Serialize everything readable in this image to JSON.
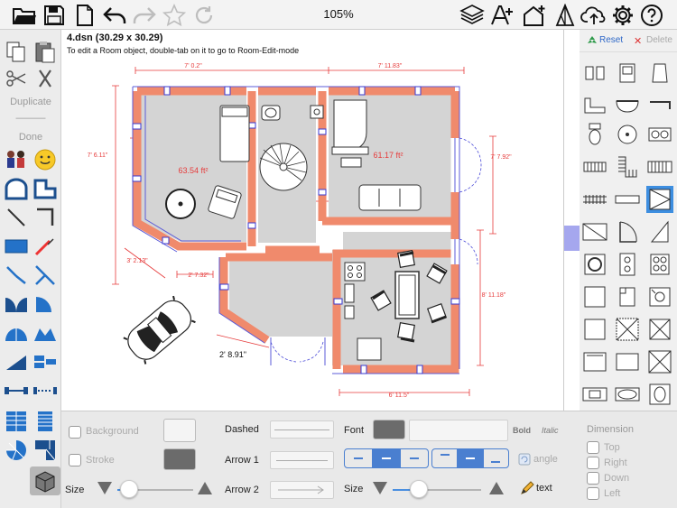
{
  "app": {
    "zoom_level": "105%",
    "file_title": "4.dsn (30.29 x 30.29)",
    "hint": "To edit a Room object, double-tab on it to go to Room-Edit-mode"
  },
  "toolbar": {
    "icons": [
      "folder-open-icon",
      "save-icon",
      "new-document-icon",
      "undo-icon",
      "redo-icon",
      "star-icon",
      "refresh-icon",
      "layers-icon",
      "text-add-icon",
      "house-add-icon",
      "perspective-icon",
      "cloud-upload-icon",
      "gear-icon",
      "help-icon"
    ]
  },
  "left_sidebar": {
    "duplicate_label": "Duplicate",
    "separator_label": "———",
    "done_label": "Done"
  },
  "right_panel": {
    "reset_label": "Reset",
    "delete_label": "Delete"
  },
  "plan": {
    "dimensions": {
      "top_left_width": "7' 0.2\"",
      "top_right_width": "7' 11.83\"",
      "left_height": "7' 6.11\"",
      "right_height": "7' 7.92\"",
      "bay_diagonal": "3' 2.13\"",
      "bay_bottom": "2' 7.32\"",
      "right_lower_height": "8' 11.18\"",
      "entry_width": "2' 8.91\"",
      "bottom_width": "6' 11.5\""
    },
    "areas": {
      "left_room": "63.54 ft²",
      "right_room": "61.17 ft²"
    },
    "colors": {
      "wall": "#f08a6c",
      "wall_outline": "#5b5bd8",
      "floor": "#d4d4d4",
      "dimension": "#e63b3b"
    }
  },
  "bottom_panel": {
    "background_label": "Background",
    "stroke_label": "Stroke",
    "size_label": "Size",
    "dashed_label": "Dashed",
    "arrow1_label": "Arrow 1",
    "arrow2_label": "Arrow 2",
    "font_label": "Font",
    "bold_label": "Bold",
    "italic_label": "Italic",
    "angle_label": "angle",
    "font_size_label": "Size",
    "text_label": "text",
    "dimension_heading": "Dimension",
    "dimension_options": [
      "Top",
      "Right",
      "Down",
      "Left"
    ],
    "line_size_value": 0.15,
    "font_size_value": 0.3,
    "align_selected": "center",
    "valign_selected": "middle"
  }
}
